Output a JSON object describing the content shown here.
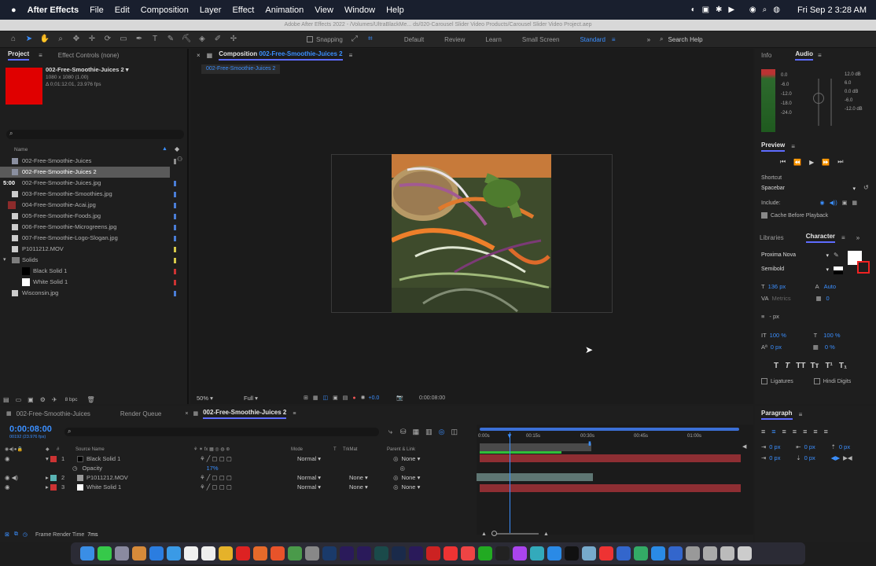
{
  "menubar": {
    "app": "After Effects",
    "items": [
      "File",
      "Edit",
      "Composition",
      "Layer",
      "Effect",
      "Animation",
      "View",
      "Window",
      "Help"
    ],
    "clock": "Fri Sep 2  3:28 AM"
  },
  "titlebar": {
    "text": "Adobe After Effects 2022 - /Volumes/UltraBlackMe... ds/020-Carousel Slider Video Products/Carousel Slider Video Project.aep"
  },
  "toolbar": {
    "snapping": "Snapping",
    "workspaces": [
      "Default",
      "Review",
      "Learn",
      "Small Screen",
      "Standard"
    ],
    "search": "Search Help"
  },
  "project": {
    "tab_project": "Project",
    "tab_effects": "Effect Controls (none)",
    "item_name": "002-Free-Smoothie-Juices 2 ▾",
    "item_size": "1080 x 1080 (1.00)",
    "item_duration": "Δ 0;01:12:01, 23.976 fps",
    "search_placeholder": "",
    "col_name": "Name",
    "items": [
      {
        "name": "002-Free-Smoothie-Juices",
        "color": "#8e8e8e"
      },
      {
        "name": "002-Free-Smoothie-Juices 2",
        "color": "#8e8e8e"
      },
      {
        "name": "002-Free-Smoothie-Juices.jpg",
        "color": "#4a7dd6"
      },
      {
        "name": "003-Free-Smoothie-Smoothies.jpg",
        "color": "#4a7dd6"
      },
      {
        "name": "004-Free-Smoothie-Acai.jpg",
        "color": "#4a7dd6"
      },
      {
        "name": "005-Free-Smoothie-Foods.jpg",
        "color": "#4a7dd6"
      },
      {
        "name": "006-Free-Smoothie-Microgreens.jpg",
        "color": "#4a7dd6"
      },
      {
        "name": "007-Free-Smoothie-Logo-Slogan.jpg",
        "color": "#4a7dd6"
      },
      {
        "name": "P1011212.MOV",
        "color": "#4a7dd6"
      },
      {
        "name": "Solids",
        "color": "#d6c94a"
      },
      {
        "name": "Black Solid 1",
        "color": "#c33"
      },
      {
        "name": "White Solid 1",
        "color": "#c33"
      },
      {
        "name": "Wisconsin.jpg",
        "color": "#4a7dd6"
      }
    ],
    "bpc": "8 bpc",
    "time_badge": "5:00"
  },
  "composition": {
    "tab_prefix": "Composition",
    "tab_name": "002-Free-Smoothie-Juices 2",
    "subtab": "002-Free-Smoothie-Juices 2",
    "zoom": "50%",
    "quality": "Full",
    "exposure": "+0.0",
    "timecode": "0:00:08:00"
  },
  "info_panel": {
    "tab_info": "Info",
    "tab_audio": "Audio",
    "db_left": [
      "0.0",
      "-6.0",
      "-12.0",
      "-18.0",
      "-24.0"
    ],
    "db_right": [
      "12.0 dB",
      "6.0",
      "0.0 dB",
      "-6.0",
      "-12.0 dB"
    ]
  },
  "preview": {
    "title": "Preview",
    "shortcut_label": "Shortcut",
    "shortcut_value": "Spacebar",
    "include_label": "Include:",
    "cache": "Cache Before Playback"
  },
  "character": {
    "tab_libraries": "Libraries",
    "tab_character": "Character",
    "font": "Proxima Nova",
    "style": "Semibold",
    "size": "136 px",
    "leading": "Auto",
    "kerning": "Metrics",
    "tracking": "0",
    "stroke": "- px",
    "v_scale": "100 %",
    "h_scale": "100 %",
    "baseline": "0 px",
    "tsume": "0 %",
    "ligatures": "Ligatures",
    "hindi": "Hindi Digits"
  },
  "paragraph": {
    "title": "Paragraph",
    "indents": [
      "0 px",
      "0 px",
      "0 px",
      "0 px",
      "0 px"
    ]
  },
  "timeline": {
    "tabs": [
      "002-Free-Smoothie-Juices",
      "Render Queue",
      "002-Free-Smoothie-Juices 2"
    ],
    "timecode": "0:00:08:00",
    "frames": "00192 (23.976 fps)",
    "col_source": "Source Name",
    "col_mode": "Mode",
    "col_t": "T",
    "col_trkmat": "TrkMat",
    "col_parent": "Parent & Link",
    "ruler": [
      "0:00s",
      "00:15s",
      "00:30s",
      "00:45s",
      "01:00s"
    ],
    "layers": [
      {
        "num": "1",
        "name": "Black Solid 1",
        "mode": "Normal",
        "trkmat": "",
        "parent": "None",
        "color": "#c33"
      },
      {
        "num": "2",
        "name": "P1011212.MOV",
        "mode": "Normal",
        "trkmat": "None",
        "parent": "None",
        "color": "#5ab3b3"
      },
      {
        "num": "3",
        "name": "White Solid 1",
        "mode": "Normal",
        "trkmat": "None",
        "parent": "None",
        "color": "#c33"
      }
    ],
    "opacity_label": "Opacity",
    "opacity_value": "17%",
    "render_time_label": "Frame Render Time",
    "render_time_value": "7ms"
  },
  "colors": {
    "accent": "#3b8fff",
    "red_solid": "#e00000"
  }
}
